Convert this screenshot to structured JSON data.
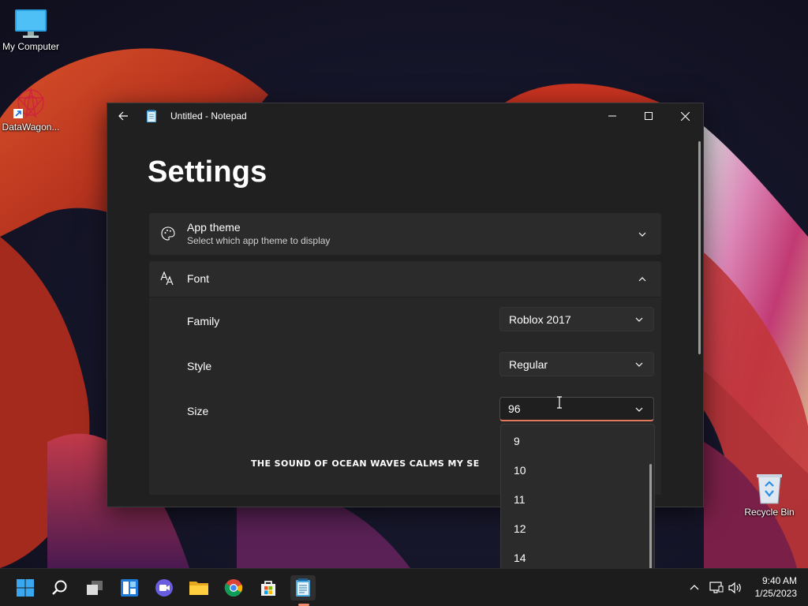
{
  "desktop": {
    "icons": [
      {
        "label": "My Computer"
      },
      {
        "label": "DataWagon..."
      },
      {
        "label": "Recycle Bin"
      }
    ]
  },
  "window": {
    "title": "Untitled - Notepad"
  },
  "settings": {
    "title": "Settings",
    "app_theme": {
      "title": "App theme",
      "subtitle": "Select which app theme to display"
    },
    "font": {
      "title": "Font",
      "family_label": "Family",
      "family_value": "Roblox 2017",
      "style_label": "Style",
      "style_value": "Regular",
      "size_label": "Size",
      "size_value": "96",
      "size_options": [
        "9",
        "10",
        "11",
        "12",
        "14"
      ],
      "preview_text": "THE SOUND OF OCEAN WAVES CALMS MY SE"
    }
  },
  "taskbar": {
    "time": "9:40 AM",
    "date": "1/25/2023"
  },
  "colors": {
    "accent": "#f08a6c",
    "window_bg": "#202020",
    "card_bg": "#2b2b2b"
  }
}
